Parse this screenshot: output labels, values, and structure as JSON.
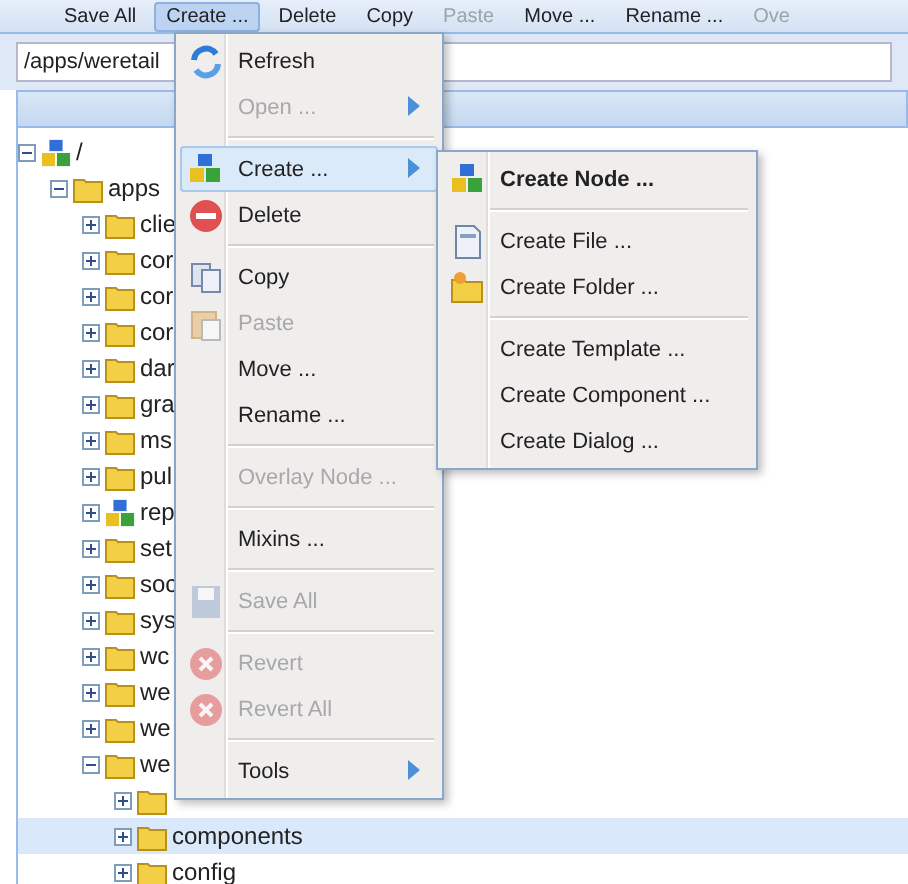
{
  "toolbar": [
    {
      "label": "Save All",
      "disabled": false,
      "selected": false
    },
    {
      "label": "Create ...",
      "disabled": false,
      "selected": true
    },
    {
      "label": "Delete",
      "disabled": false,
      "selected": false
    },
    {
      "label": "Copy",
      "disabled": false,
      "selected": false
    },
    {
      "label": "Paste",
      "disabled": true,
      "selected": false
    },
    {
      "label": "Move ...",
      "disabled": false,
      "selected": false
    },
    {
      "label": "Rename ...",
      "disabled": false,
      "selected": false
    },
    {
      "label": "Ove",
      "disabled": true,
      "selected": false
    }
  ],
  "path_field": {
    "value": "/apps/weretail"
  },
  "tree": [
    {
      "label": "/",
      "kind": "node",
      "expanded": true,
      "selected": false,
      "children": [
        {
          "label": "apps",
          "kind": "folder",
          "expanded": true,
          "selected": false,
          "children": [
            {
              "label": "clie",
              "kind": "folder",
              "expanded": false,
              "selected": false
            },
            {
              "label": "cor",
              "kind": "folder",
              "expanded": false,
              "selected": false
            },
            {
              "label": "cor",
              "kind": "folder",
              "expanded": false,
              "selected": false
            },
            {
              "label": "cor",
              "kind": "folder",
              "expanded": false,
              "selected": false
            },
            {
              "label": "dar",
              "kind": "folder",
              "expanded": false,
              "selected": false
            },
            {
              "label": "gra",
              "kind": "folder",
              "expanded": false,
              "selected": false
            },
            {
              "label": "ms",
              "kind": "folder",
              "expanded": false,
              "selected": false
            },
            {
              "label": "pul",
              "kind": "folder",
              "expanded": false,
              "selected": false
            },
            {
              "label": "rep",
              "kind": "node",
              "expanded": false,
              "selected": false
            },
            {
              "label": "set",
              "kind": "folder",
              "expanded": false,
              "selected": false
            },
            {
              "label": "soc",
              "kind": "folder",
              "expanded": false,
              "selected": false
            },
            {
              "label": "sys",
              "kind": "folder",
              "expanded": false,
              "selected": false
            },
            {
              "label": "wc",
              "kind": "folder",
              "expanded": false,
              "selected": false
            },
            {
              "label": "we",
              "kind": "folder",
              "expanded": false,
              "selected": false
            },
            {
              "label": "we",
              "kind": "folder",
              "expanded": false,
              "selected": false
            },
            {
              "label": "we",
              "kind": "folder",
              "expanded": true,
              "selected": false,
              "children": [
                {
                  "kind": "folder",
                  "expanded": false,
                  "selected": false
                },
                {
                  "label": "components",
                  "kind": "folder",
                  "expanded": false,
                  "selected": true
                },
                {
                  "label": "config",
                  "kind": "folder",
                  "expanded": false,
                  "selected": false
                }
              ]
            }
          ]
        }
      ]
    }
  ],
  "context_menu": [
    {
      "kind": "item",
      "label": "Refresh",
      "disabled": false,
      "selected": false,
      "submenu": false
    },
    {
      "kind": "item",
      "label": "Open ...",
      "disabled": true,
      "selected": false,
      "submenu": true
    },
    {
      "kind": "separator"
    },
    {
      "kind": "item",
      "label": "Create ...",
      "disabled": false,
      "selected": true,
      "submenu": true
    },
    {
      "kind": "item",
      "label": "Delete",
      "disabled": false,
      "selected": false,
      "submenu": false
    },
    {
      "kind": "separator"
    },
    {
      "kind": "item",
      "label": "Copy",
      "disabled": false,
      "selected": false,
      "submenu": false
    },
    {
      "kind": "item",
      "label": "Paste",
      "disabled": true,
      "selected": false,
      "submenu": false
    },
    {
      "kind": "item",
      "label": "Move ...",
      "disabled": false,
      "selected": false,
      "submenu": false
    },
    {
      "kind": "item",
      "label": "Rename ...",
      "disabled": false,
      "selected": false,
      "submenu": false
    },
    {
      "kind": "separator"
    },
    {
      "kind": "item",
      "label": "Overlay Node ...",
      "disabled": true,
      "selected": false,
      "submenu": false
    },
    {
      "kind": "separator"
    },
    {
      "kind": "item",
      "label": "Mixins ...",
      "disabled": false,
      "selected": false,
      "submenu": false
    },
    {
      "kind": "separator"
    },
    {
      "kind": "item",
      "label": "Save All",
      "disabled": true,
      "selected": false,
      "submenu": false
    },
    {
      "kind": "separator"
    },
    {
      "kind": "item",
      "label": "Revert",
      "disabled": true,
      "selected": false,
      "submenu": false
    },
    {
      "kind": "item",
      "label": "Revert All",
      "disabled": true,
      "selected": false,
      "submenu": false
    },
    {
      "kind": "separator"
    },
    {
      "kind": "item",
      "label": "Tools",
      "disabled": false,
      "selected": false,
      "submenu": true
    }
  ],
  "submenu": [
    {
      "kind": "item",
      "label": "Create Node ...",
      "bold": true
    },
    {
      "kind": "separator"
    },
    {
      "kind": "item",
      "label": "Create File ...",
      "bold": false
    },
    {
      "kind": "item",
      "label": "Create Folder ...",
      "bold": false
    },
    {
      "kind": "separator"
    },
    {
      "kind": "item",
      "label": "Create Template ...",
      "bold": false
    },
    {
      "kind": "item",
      "label": "Create Component ...",
      "bold": false
    },
    {
      "kind": "item",
      "label": "Create Dialog ...",
      "bold": false
    }
  ]
}
